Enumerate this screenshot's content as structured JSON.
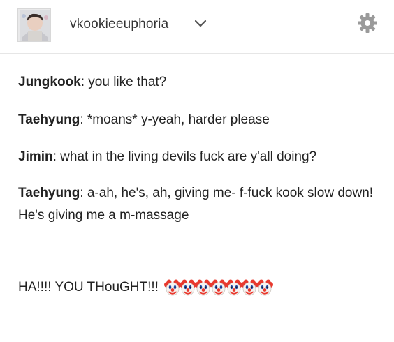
{
  "post": {
    "username": "vkookieeuphoria",
    "lines": [
      {
        "speaker": "Jungkook",
        "text": " you like that?"
      },
      {
        "speaker": "Taehyung",
        "text": " *moans* y-yeah, harder please"
      },
      {
        "speaker": "Jimin",
        "text": " what in the living devils fuck are y'all doing?"
      },
      {
        "speaker": "Taehyung",
        "text": " a-ah, he's, ah, giving me- f-fuck kook slow down! He's giving me a m-massage"
      }
    ],
    "punchline": "HA!!!! YOU THouGHT!!!",
    "emoji": "clown-face-icon",
    "emoji_count": 7
  },
  "colors": {
    "text": "#222222",
    "clown_red": "#e8392e",
    "clown_face": "#f6f3f0",
    "gear": "#9a9a9a"
  }
}
